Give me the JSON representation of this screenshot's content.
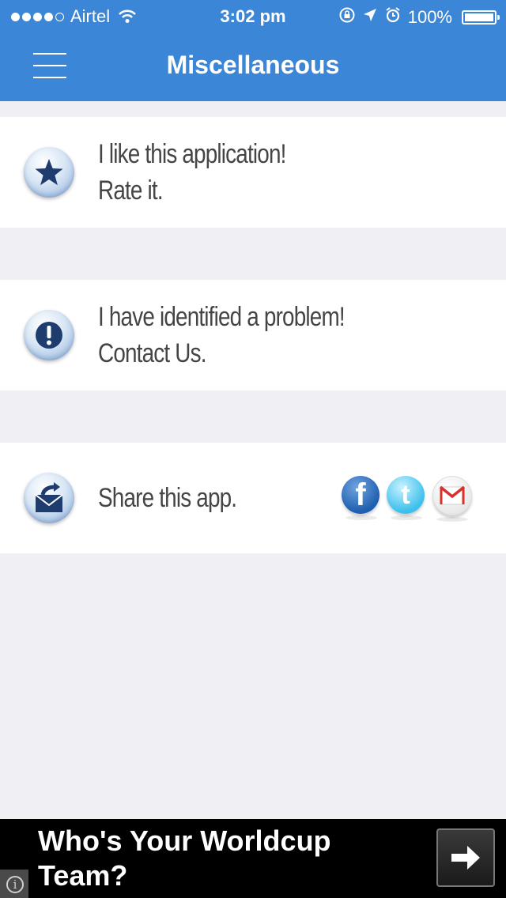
{
  "status_bar": {
    "carrier": "Airtel",
    "time": "3:02 pm",
    "battery": "100%"
  },
  "nav": {
    "title": "Miscellaneous",
    "menu_icon": "hamburger-menu-icon"
  },
  "items": [
    {
      "line1": "I like this application!",
      "line2": "Rate it.",
      "icon": "star-icon"
    },
    {
      "line1": "I have identified a problem!",
      "line2": "Contact Us.",
      "icon": "exclamation-icon"
    },
    {
      "line1": "Share this app.",
      "icon": "share-mail-icon"
    }
  ],
  "share": {
    "facebook_glyph": "f",
    "twitter_glyph": "t",
    "icons": [
      "facebook-icon",
      "twitter-icon",
      "gmail-icon"
    ]
  },
  "ad": {
    "text": "Who's Your Worldcup Team?",
    "info_glyph": "i"
  },
  "colors": {
    "header": "#3b86d6",
    "background": "#efeff4",
    "text": "#454545",
    "icon_dark": "#1e3c6e"
  }
}
